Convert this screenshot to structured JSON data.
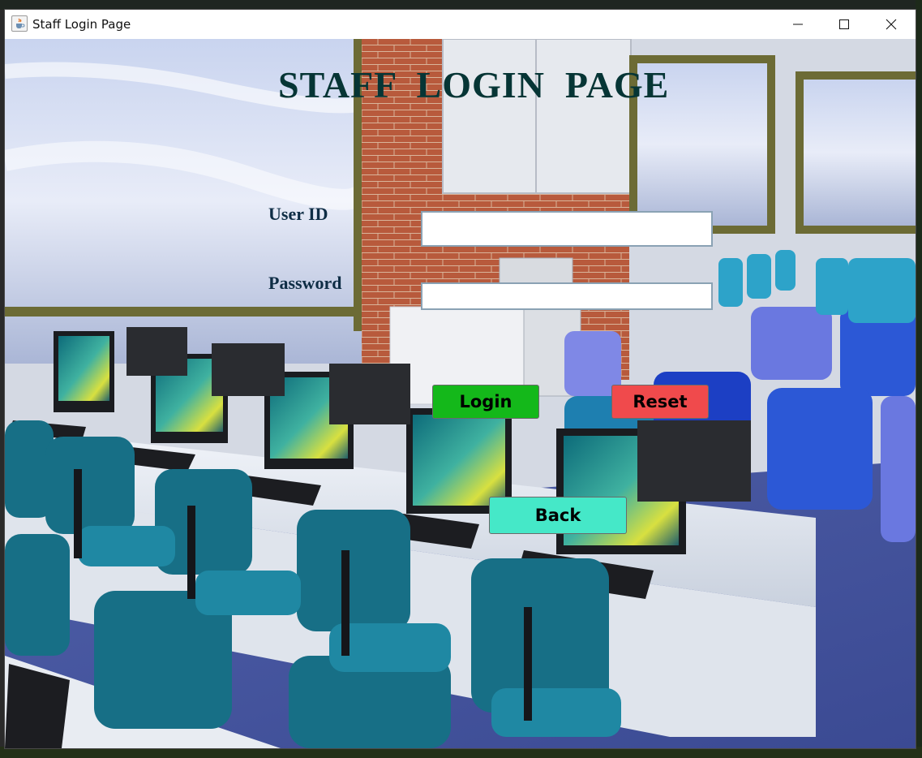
{
  "window": {
    "title": "Staff Login Page",
    "icon": "java-cup-icon",
    "controls": {
      "minimize": "minimize-icon",
      "maximize": "maximize-icon",
      "close": "close-icon"
    }
  },
  "page": {
    "heading": "STAFF  LOGIN  PAGE"
  },
  "form": {
    "user_id_label": "User ID",
    "user_id_value": "",
    "password_label": "Password",
    "password_value": ""
  },
  "buttons": {
    "login": "Login",
    "reset": "Reset",
    "back": "Back"
  },
  "colors": {
    "heading": "#063535",
    "labels": "#0e2d45",
    "login": "#14b81a",
    "reset": "#f04a4c",
    "back": "#45e8c8"
  }
}
